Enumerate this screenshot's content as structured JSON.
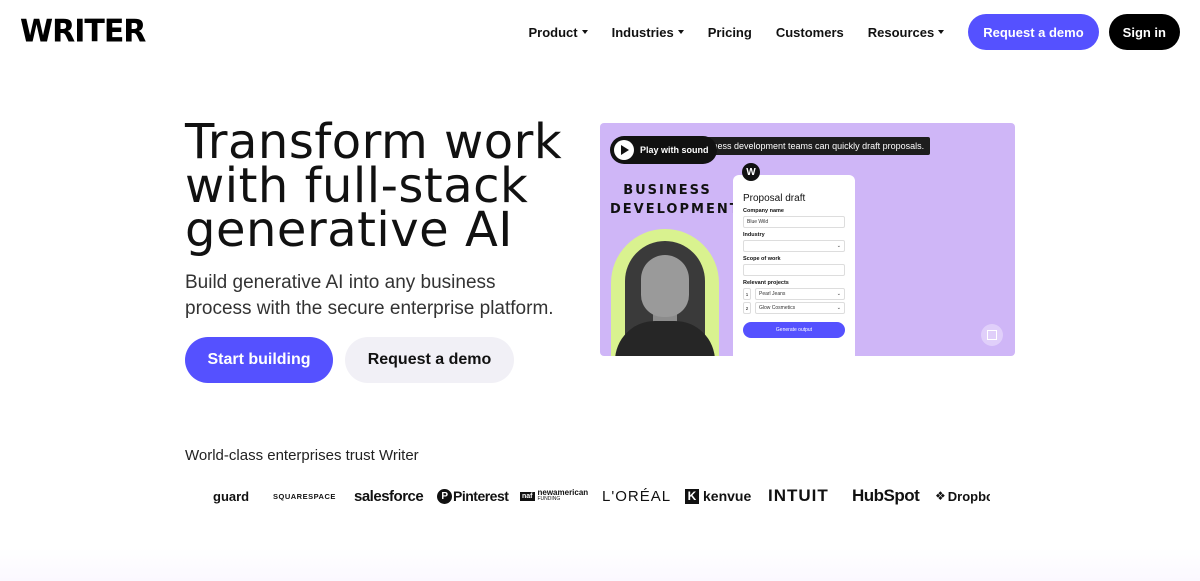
{
  "header": {
    "logo": "WRITER",
    "nav": [
      {
        "label": "Product",
        "has_menu": true
      },
      {
        "label": "Industries",
        "has_menu": true
      },
      {
        "label": "Pricing",
        "has_menu": false
      },
      {
        "label": "Customers",
        "has_menu": false
      },
      {
        "label": "Resources",
        "has_menu": true
      }
    ],
    "request_demo": "Request a demo",
    "sign_in": "Sign in"
  },
  "hero": {
    "title": "Transform work with full-stack generative AI",
    "subtitle": "Build generative AI into any business process with the secure enterprise platform.",
    "start_building": "Start building",
    "request_demo": "Request a demo"
  },
  "video": {
    "play_label": "Play with sound",
    "caption": "siness development teams can quickly draft proposals.",
    "heading": "BUSINESS DEVELOPMENT",
    "form": {
      "logo_letter": "W",
      "title": "Proposal draft",
      "company_label": "Company name",
      "company_value": "Blue Wild",
      "industry_label": "Industry",
      "scope_label": "Scope of work",
      "projects_label": "Relevant projects",
      "projects": [
        {
          "num": "1",
          "name": "Pearl Jeans"
        },
        {
          "num": "2",
          "name": "Glow Cosmetics"
        }
      ],
      "generate": "Generate output"
    }
  },
  "trust": {
    "label": "World-class enterprises trust Writer",
    "logos": {
      "guard": "guard",
      "squarespace": "SQUARESPACE",
      "salesforce": "salesforce",
      "pinterest": "Pinterest",
      "newamerican": "newamerican",
      "newamerican_sub": "FUNDING",
      "loreal": "L'ORÉAL",
      "kenvue": "kenvue",
      "intuit": "INTUIT",
      "hubspot": "HubSpot",
      "dropbox": "Dropbox"
    }
  },
  "colors": {
    "accent": "#5551ff",
    "video_bg": "#cfb6f7",
    "portrait_bg": "#d9f28f"
  }
}
